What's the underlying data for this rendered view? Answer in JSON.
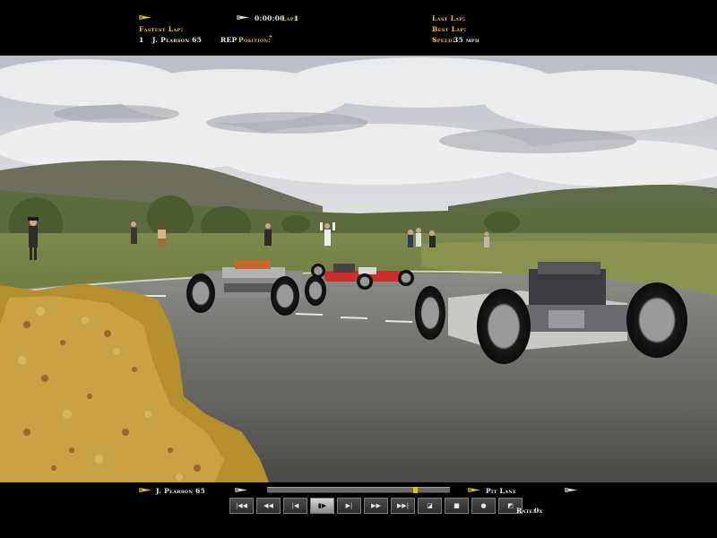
{
  "hud_top": {
    "session_time": "0:00:00",
    "lap_label": "Lap:",
    "lap_value": "1",
    "fastest_lap_label": "Fastest Lap:",
    "fastest_lap_index": "1",
    "fastest_lap_driver": "J. Pearson 65",
    "fastest_lap_tag": "REP",
    "position_label": "Position:",
    "position_value": "\"",
    "last_lap_label": "Last Lap:",
    "best_lap_label": "Best Lap:",
    "speed_label": "Speed:",
    "speed_value": "35 mph"
  },
  "hud_bottom": {
    "driver": "J. Pearson 65",
    "camera": "Pit Lane",
    "rate_label": "Rate:",
    "rate_value": "0x",
    "replay_position": 0.82,
    "transport_buttons": [
      {
        "icon": "skip-to-start-icon",
        "glyph": "|◀◀"
      },
      {
        "icon": "rewind-icon",
        "glyph": "◀◀"
      },
      {
        "icon": "step-back-icon",
        "glyph": "|◀"
      },
      {
        "icon": "pause-icon",
        "glyph": "▮▶"
      },
      {
        "icon": "step-forward-icon",
        "glyph": "▶|"
      },
      {
        "icon": "fast-forward-icon",
        "glyph": "▶▶"
      },
      {
        "icon": "skip-to-end-icon",
        "glyph": "▶▶|"
      },
      {
        "icon": "go-to-car-icon",
        "glyph": "◪"
      },
      {
        "icon": "stop-icon",
        "glyph": "■"
      },
      {
        "icon": "record-icon",
        "glyph": "●"
      },
      {
        "icon": "camera-icon",
        "glyph": "◩"
      }
    ]
  },
  "colors": {
    "hud_label": "#f2c200",
    "hud_value": "#f0ecd8",
    "background": "#000000"
  }
}
